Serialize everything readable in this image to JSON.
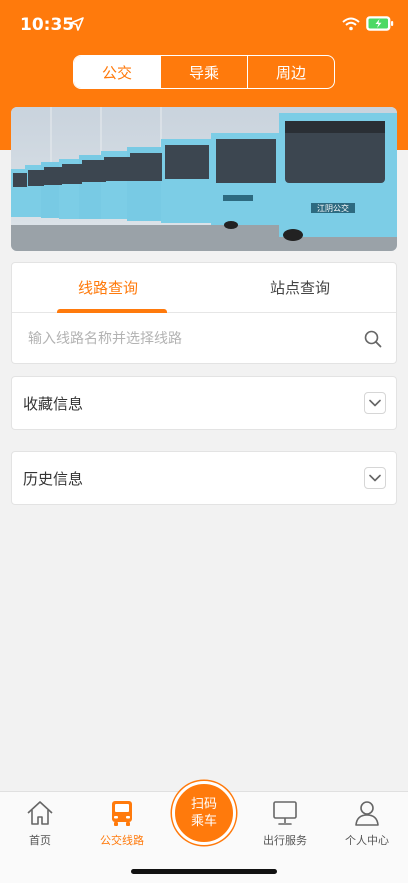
{
  "status_bar": {
    "time": "10:35"
  },
  "segments": [
    {
      "label": "公交",
      "active": true
    },
    {
      "label": "导乘",
      "active": false
    },
    {
      "label": "周边",
      "active": false
    }
  ],
  "banner": {
    "bus_sign_text": "江阴公交"
  },
  "query": {
    "tabs": [
      {
        "label": "线路查询",
        "active": true
      },
      {
        "label": "站点查询",
        "active": false
      }
    ],
    "search": {
      "placeholder": "输入线路名称并选择线路",
      "value": ""
    }
  },
  "sections": {
    "favorites": {
      "title": "收藏信息"
    },
    "history": {
      "title": "历史信息"
    }
  },
  "bottom_nav": {
    "items": [
      {
        "label": "首页",
        "icon": "home-icon",
        "active": false
      },
      {
        "label": "公交线路",
        "icon": "bus-icon",
        "active": true
      },
      {
        "label": "出行服务",
        "icon": "monitor-icon",
        "active": false
      },
      {
        "label": "个人中心",
        "icon": "person-icon",
        "active": false
      }
    ],
    "scan": {
      "line1": "扫码",
      "line2": "乘车"
    }
  },
  "colors": {
    "accent": "#ff7a0c",
    "background": "#f2f2f2",
    "bus_body": "#7ccde6"
  }
}
